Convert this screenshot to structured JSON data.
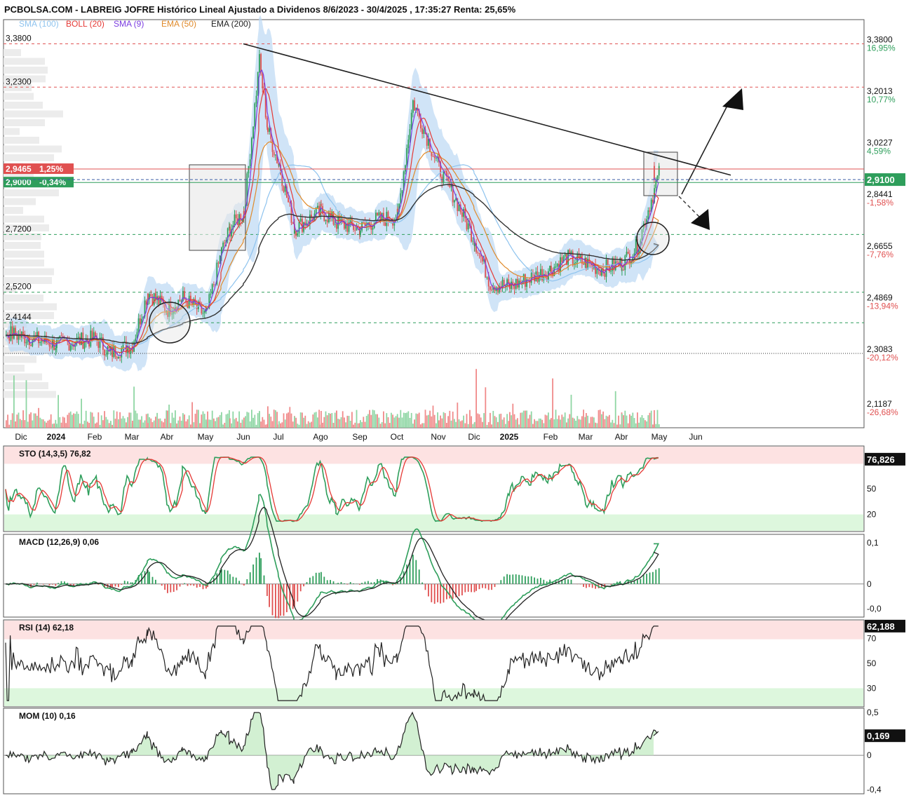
{
  "header": {
    "title": "PCBOLSA.COM - LABREIG JOFRE Histórico Lineal Ajustado a Dividenos 8/6/2023 - 30/4/2025 , 17:35:27 Renta: 25,65%"
  },
  "legend": [
    {
      "label": "SMA (100)",
      "color": "#8ec3ee"
    },
    {
      "label": "BOLL (20)",
      "color": "#e53935"
    },
    {
      "label": "SMA (9)",
      "color": "#7a3be0"
    },
    {
      "label": "EMA (50)",
      "color": "#e08a2a"
    },
    {
      "label": "EMA (200)",
      "color": "#222222"
    }
  ],
  "colors": {
    "up": "#2e9e5b",
    "down": "#e05050",
    "boll_fill": "#bcd8f3",
    "grid_red": "#e05555",
    "grid_green": "#2e9e5b"
  },
  "chart_data": {
    "type": "candlestick",
    "x_months": [
      "Dic",
      "2024",
      "Feb",
      "Mar",
      "Abr",
      "May",
      "Jun",
      "Jul",
      "Ago",
      "Sep",
      "Oct",
      "Nov",
      "Dic",
      "2025",
      "Feb",
      "Mar",
      "Abr",
      "May",
      "Jun"
    ],
    "bold_months": [
      "2024",
      "2025"
    ],
    "ylim": [
      2.08,
      3.42
    ],
    "left_levels": [
      {
        "label": "3,3800",
        "value": 3.38,
        "style": "red"
      },
      {
        "label": "3,2300",
        "value": 3.23,
        "style": "red"
      },
      {
        "label": "2,7200",
        "value": 2.72,
        "style": "green"
      },
      {
        "label": "2,5200",
        "value": 2.52,
        "style": "green"
      },
      {
        "label": "2,4144",
        "value": 2.4144,
        "style": "green"
      }
    ],
    "right_ticks": [
      {
        "label": "3,3800",
        "value": 3.38,
        "pct": "16,95%",
        "pct_color": "#2e9e5b"
      },
      {
        "label": "3,2013",
        "value": 3.2013,
        "pct": "10,77%",
        "pct_color": "#2e9e5b"
      },
      {
        "label": "3,0227",
        "value": 3.0227,
        "pct": "4,59%",
        "pct_color": "#2e9e5b"
      },
      {
        "label": "2,8441",
        "value": 2.8441,
        "pct": "-1,58%",
        "pct_color": "#e05050"
      },
      {
        "label": "2,6655",
        "value": 2.6655,
        "pct": "-7,76%",
        "pct_color": "#e05050"
      },
      {
        "label": "2,4869",
        "value": 2.4869,
        "pct": "-13,94%",
        "pct_color": "#e05050"
      },
      {
        "label": "2,3083",
        "value": 2.3083,
        "pct": "-20,12%",
        "pct_color": "#e05050"
      },
      {
        "label": "2,1187",
        "value": 2.1187,
        "pct": "-26,68%",
        "pct_color": "#e05050"
      }
    ],
    "reference_line": {
      "value": 2.3083
    },
    "price_tags": [
      {
        "label": "2,9465",
        "pct": "1,25%",
        "value": 2.9465,
        "color": "#e05050"
      },
      {
        "label": "2,9000",
        "pct": "-0,34%",
        "value": 2.9,
        "color": "#2e9e5b"
      }
    ],
    "last_price": {
      "label": "2,9100",
      "value": 2.91,
      "color": "#2e9e5b"
    },
    "trendline": {
      "from": [
        "Jun",
        3.38
      ],
      "to": [
        "May",
        2.94
      ]
    },
    "price_path": [
      [
        "Dic",
        2.38
      ],
      [
        "2024",
        2.34
      ],
      [
        "Feb",
        2.36
      ],
      [
        "Feb",
        2.31
      ],
      [
        "Mar",
        2.34
      ],
      [
        "Mar",
        2.52
      ],
      [
        "Abr",
        2.46
      ],
      [
        "Abr",
        2.5
      ],
      [
        "May",
        2.44
      ],
      [
        "May",
        2.66
      ],
      [
        "May",
        2.74
      ],
      [
        "Jun",
        2.8
      ],
      [
        "Jun",
        3.32
      ],
      [
        "Jun",
        3.08
      ],
      [
        "Jul",
        2.96
      ],
      [
        "Jul",
        2.74
      ],
      [
        "Ago",
        2.8
      ],
      [
        "Ago",
        2.76
      ],
      [
        "Sep",
        2.74
      ],
      [
        "Sep",
        2.77
      ],
      [
        "Oct",
        2.78
      ],
      [
        "Oct",
        3.18
      ],
      [
        "Nov",
        2.95
      ],
      [
        "Nov",
        2.85
      ],
      [
        "Dic",
        2.7
      ],
      [
        "Dic",
        2.55
      ],
      [
        "2025",
        2.54
      ],
      [
        "Feb",
        2.6
      ],
      [
        "Feb",
        2.64
      ],
      [
        "Mar",
        2.62
      ],
      [
        "Mar",
        2.6
      ],
      [
        "Abr",
        2.62
      ],
      [
        "Abr",
        2.68
      ],
      [
        "May",
        2.94
      ],
      [
        "May",
        2.91
      ]
    ],
    "stochastic": {
      "label": "STO (14,3,5)",
      "value": "76,82",
      "last": "76,826",
      "ticks": [
        {
          "label": "50",
          "value": 50
        },
        {
          "label": "20",
          "value": 20
        }
      ],
      "overbought": 80,
      "oversold": 20,
      "ylim": [
        0,
        100
      ]
    },
    "macd": {
      "label": "MACD (12,26,9)",
      "value": "0,06",
      "ticks": [
        {
          "label": "0,1",
          "value": 0.1,
          "color": "#e05050"
        },
        {
          "label": "0",
          "value": 0,
          "color": "#111"
        },
        {
          "label": "-0,0",
          "value": -0.06,
          "color": "#2e9e5b"
        }
      ],
      "ylim": [
        -0.08,
        0.12
      ]
    },
    "rsi": {
      "label": "RSI (14)",
      "value": "62,18",
      "last": "62,188",
      "ticks": [
        {
          "label": "70",
          "value": 70,
          "color": "#e05050"
        },
        {
          "label": "50",
          "value": 50,
          "color": "#111"
        },
        {
          "label": "30",
          "value": 30,
          "color": "#2e9e5b"
        }
      ],
      "ylim": [
        15,
        85
      ]
    },
    "momentum": {
      "label": "MOM (10)",
      "value": "0,16",
      "last": "0,169",
      "ticks": [
        {
          "label": "0,5",
          "value": 0.5,
          "color": "#e05050"
        },
        {
          "label": "0",
          "value": 0,
          "color": "#111"
        },
        {
          "label": "-0,4",
          "value": -0.4,
          "color": "#2e9e5b"
        }
      ],
      "ylim": [
        -0.45,
        0.55
      ]
    }
  }
}
